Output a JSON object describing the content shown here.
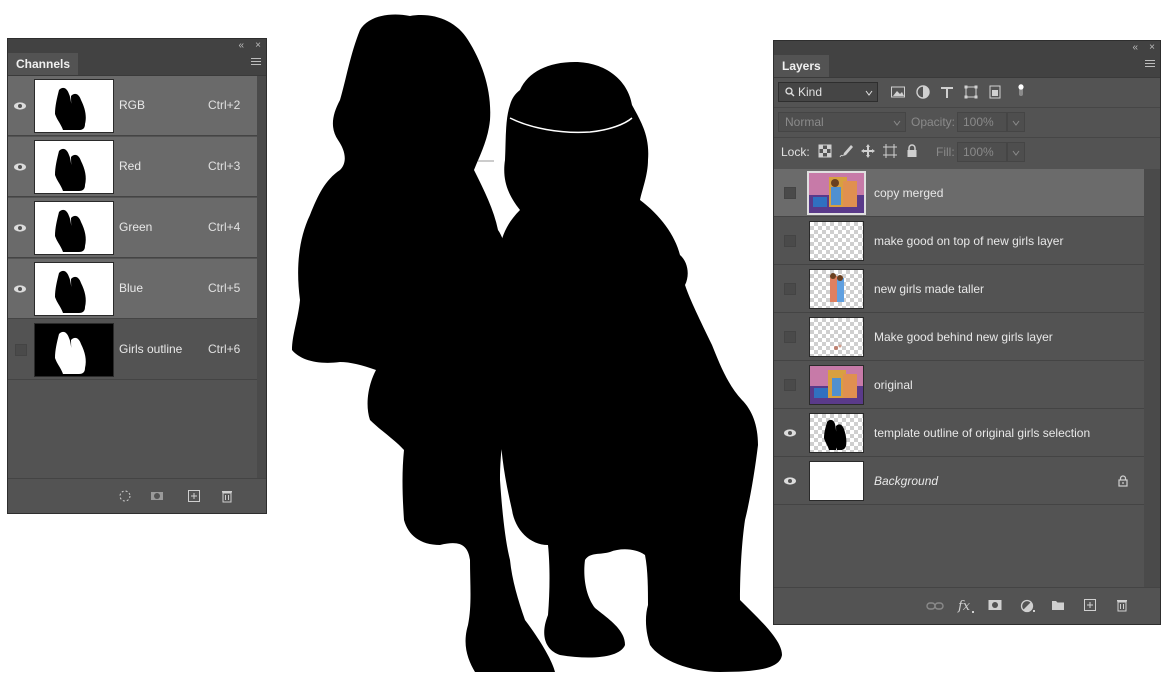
{
  "channels_panel": {
    "tab_label": "Channels",
    "collapse_label": "«",
    "close_label": "×",
    "rows": [
      {
        "name": "RGB",
        "shortcut": "Ctrl+2",
        "visible": true,
        "selected": true,
        "thumb": "silhouette-black-on-white"
      },
      {
        "name": "Red",
        "shortcut": "Ctrl+3",
        "visible": true,
        "selected": true,
        "thumb": "silhouette-black-on-white"
      },
      {
        "name": "Green",
        "shortcut": "Ctrl+4",
        "visible": true,
        "selected": true,
        "thumb": "silhouette-black-on-white"
      },
      {
        "name": "Blue",
        "shortcut": "Ctrl+5",
        "visible": true,
        "selected": true,
        "thumb": "silhouette-black-on-white"
      },
      {
        "name": "Girls outline",
        "shortcut": "Ctrl+6",
        "visible": false,
        "selected": false,
        "thumb": "silhouette-white-on-black"
      }
    ],
    "footer_icons": [
      "load-selection-icon",
      "save-selection-icon",
      "new-channel-icon",
      "delete-channel-icon"
    ]
  },
  "layers_panel": {
    "tab_label": "Layers",
    "collapse_label": "«",
    "close_label": "×",
    "filter": {
      "label": "Kind",
      "icons": [
        "pixel-filter-icon",
        "adjustment-filter-icon",
        "type-filter-icon",
        "shape-filter-icon",
        "smart-object-filter-icon",
        "filter-toggle-icon"
      ]
    },
    "blend_mode": "Normal",
    "opacity_label": "Opacity:",
    "opacity_value": "100%",
    "lock_label": "Lock:",
    "fill_label": "Fill:",
    "fill_value": "100%",
    "layers": [
      {
        "name": "copy merged",
        "visible": false,
        "selected": true,
        "thumb": "color-photo",
        "locked": false,
        "italic": false
      },
      {
        "name": "make good on top of new girls layer",
        "visible": false,
        "selected": false,
        "thumb": "transparent",
        "locked": false,
        "italic": false
      },
      {
        "name": "new girls made taller",
        "visible": false,
        "selected": false,
        "thumb": "girls-transparent",
        "locked": false,
        "italic": false
      },
      {
        "name": "Make good behind new girls layer",
        "visible": false,
        "selected": false,
        "thumb": "transparent-faint",
        "locked": false,
        "italic": false
      },
      {
        "name": "original",
        "visible": false,
        "selected": false,
        "thumb": "color-photo",
        "locked": false,
        "italic": false
      },
      {
        "name": "template outline of original girls selection",
        "visible": true,
        "selected": false,
        "thumb": "black-silhouette-transparent",
        "locked": false,
        "italic": false
      },
      {
        "name": "Background",
        "visible": true,
        "selected": false,
        "thumb": "white",
        "locked": true,
        "italic": true
      }
    ],
    "footer_icons": [
      "link-layers-icon",
      "fx-icon",
      "layer-mask-icon",
      "adjustment-layer-icon",
      "group-folder-icon",
      "new-layer-icon",
      "delete-layer-icon"
    ]
  },
  "colors": {
    "panel": "#535353",
    "selected_row": "#6a6a6a",
    "header": "#424242",
    "canvas": "#ffffff",
    "silhouette": "#000000"
  }
}
